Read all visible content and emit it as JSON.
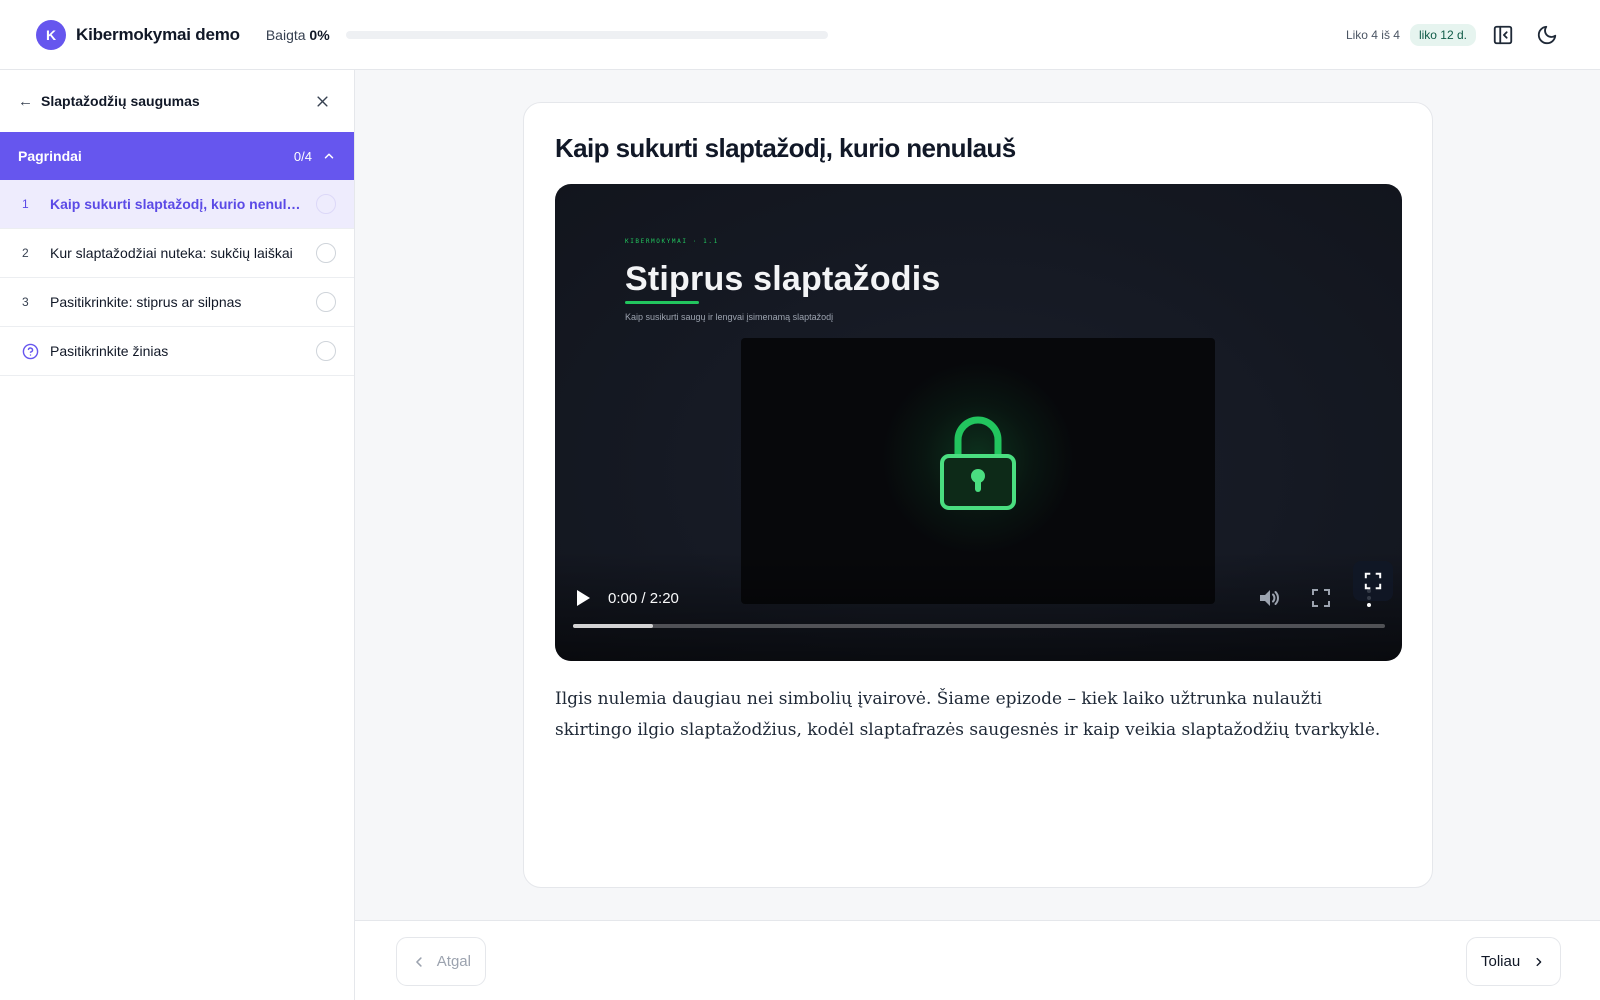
{
  "header": {
    "brand_initial": "K",
    "brand_name": "Kibermokymai demo",
    "progress_label": "Baigta",
    "progress_value": "0%",
    "progress_fraction": 0,
    "remaining_text": "Liko 4 iš 4",
    "days_left_badge": "liko 12 d.",
    "collapse_sidebar_icon": "sidebar-collapse-icon",
    "theme_icon": "moon-icon"
  },
  "sidebar": {
    "course_title": "Slaptažodžių saugumas",
    "section": {
      "title": "Pagrindai",
      "count": "0/4"
    },
    "lessons": [
      {
        "number": "1",
        "title": "Kaip sukurti slaptažodį, kurio nenulauš",
        "active": true
      },
      {
        "number": "2",
        "title": "Kur slaptažodžiai nuteka: sukčių laiškai",
        "active": false
      },
      {
        "number": "3",
        "title": "Pasitikrinkite: stiprus ar silpnas",
        "active": false
      },
      {
        "number": "",
        "title": "Pasitikrinkite žinias",
        "active": false,
        "icon": "question-circle-icon"
      }
    ]
  },
  "lesson": {
    "title": "Kaip sukurti slaptažodį, kurio nenulauš",
    "description": "Ilgis nulemia daugiau nei simbolių įvairovė. Šiame epizode – kiek laiko užtrunka nulaužti skirtingo ilgio slaptažodžius, kodėl slaptafrazės saugesnės ir kaip veikia slaptažodžių tvarkyklė."
  },
  "video": {
    "kicker": "KIBERMOKYMAI · 1.1",
    "title": "Stiprus slaptažodis",
    "subtitle": "Kaip susikurti saugų ir lengvai įsimenamą slaptažodį",
    "time": "0:00 / 2:20",
    "buffered_fraction": 0.098,
    "accent_color": "#22c55e"
  },
  "footer": {
    "back_label": "Atgal",
    "next_label": "Toliau"
  },
  "colors": {
    "primary": "#6656ee",
    "badge_bg": "#e6f4ef",
    "badge_text": "#0f5b47"
  }
}
